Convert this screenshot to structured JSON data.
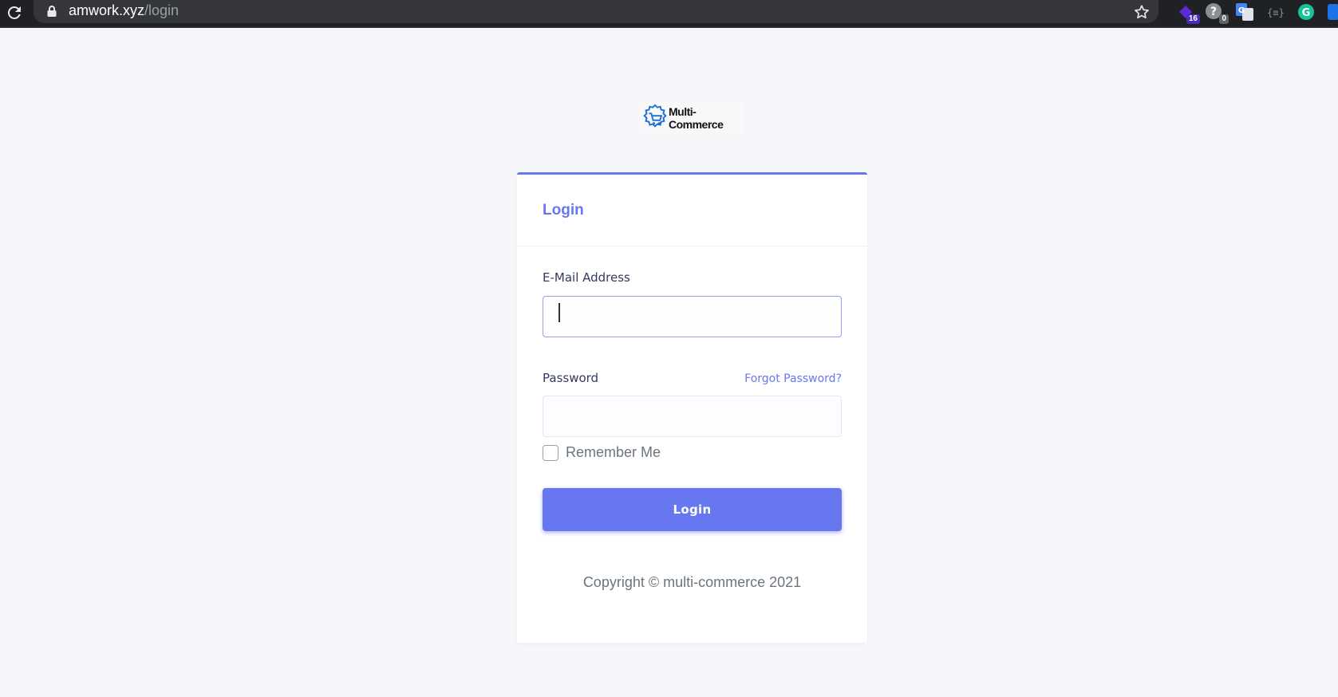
{
  "browser": {
    "url_host": "amwork.xyz",
    "url_path": "/login",
    "extensions": [
      {
        "icon": "ext-purple-icon",
        "badge": "16",
        "color": "#5b2bd6",
        "badge_color": "#4a2bb8"
      },
      {
        "icon": "ext-help-icon",
        "badge": "0",
        "color": "#8a8f96",
        "badge_color": "#5f6368"
      },
      {
        "icon": "google-translate-icon",
        "badge": "",
        "color": "#4285f4",
        "badge_color": ""
      },
      {
        "icon": "ext-brackets-icon",
        "badge": "",
        "color": "#5f6368",
        "badge_color": ""
      },
      {
        "icon": "grammarly-icon",
        "badge": "",
        "color": "#15c39a",
        "badge_color": ""
      },
      {
        "icon": "ext-partial-icon",
        "badge": "",
        "color": "#1a73e8",
        "badge_color": ""
      }
    ]
  },
  "logo": {
    "text": "Multi-Commerce",
    "color": "#1b6fd6"
  },
  "login_card": {
    "title": "Login",
    "email_label": "E-Mail Address",
    "email_value": "",
    "password_label": "Password",
    "forgot_link": "Forgot Password?",
    "password_value": "",
    "remember_label": "Remember Me",
    "remember_checked": false,
    "submit_label": "Login",
    "accent_color": "#6777ef"
  },
  "footer": {
    "copyright": "Copyright © multi-commerce 2021"
  }
}
